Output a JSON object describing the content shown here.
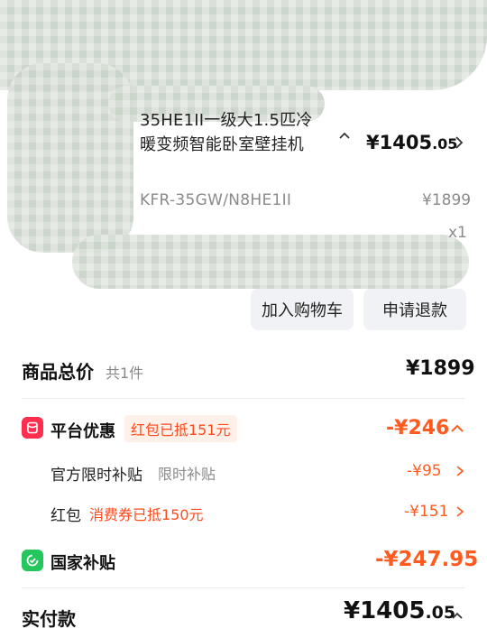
{
  "product": {
    "title": "一级大1.5匹冷暖变频智能卧室壁挂机",
    "title_lines": [
      "35HE1II一级大1.5匹冷",
      "暖变频智能卧室壁挂机"
    ],
    "model": "KFR-35GW/N8HE1II",
    "price_yen": "¥1405",
    "price_cents": ".05",
    "original_price": "¥1899",
    "quantity": "x1"
  },
  "actions": {
    "add_to_cart": "加入购物车",
    "refund": "申请退款"
  },
  "summary": {
    "total_label": "商品总价",
    "total_count": "共1件",
    "total_value": "¥1899",
    "platform": {
      "label": "平台优惠",
      "tag": "红包已抵151元",
      "value": "-¥246"
    },
    "official_subsidy": {
      "label": "官方限时补贴",
      "tag": "限时补贴",
      "value": "-¥95"
    },
    "red_packet": {
      "label": "红包",
      "tag": "消费券已抵150元",
      "value": "-¥151"
    },
    "national_subsidy": {
      "label": "国家补贴",
      "value": "-¥247.95"
    },
    "paid_label": "实付款",
    "paid_yen": "¥1405",
    "paid_cents": ".05"
  },
  "colors": {
    "accent": "#ff5a1f",
    "platform_icon": "#ff2e4f",
    "national_icon": "#24c75e"
  },
  "icons": [
    "chevron-up-icon",
    "chevron-right-icon",
    "red-packet-icon",
    "subsidy-icon"
  ]
}
